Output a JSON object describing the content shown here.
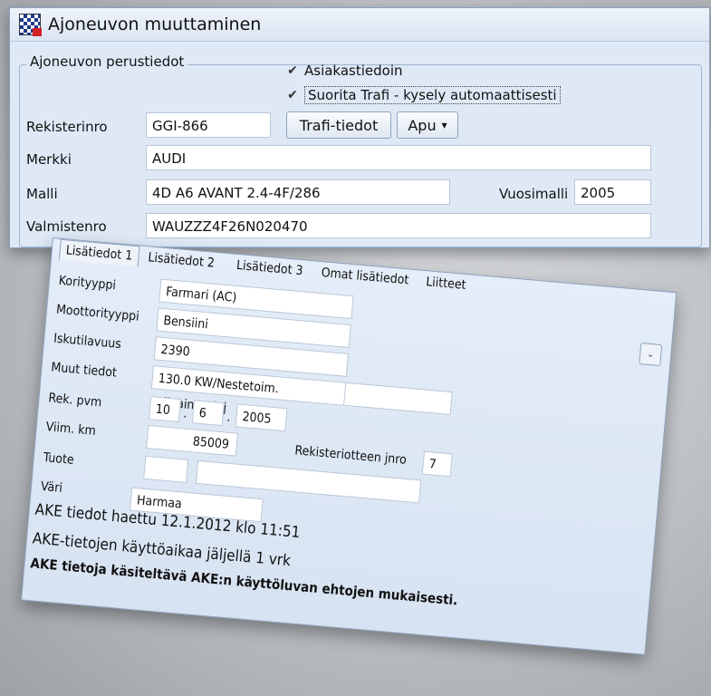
{
  "window": {
    "title": "Ajoneuvon muuttaminen"
  },
  "group": {
    "legend": "Ajoneuvon perustiedot"
  },
  "checkboxes": [
    {
      "label": "Asiakastiedoin",
      "checked": "✔"
    },
    {
      "label": "Suorita Trafi - kysely automaattisesti",
      "checked": "✔"
    }
  ],
  "fields": {
    "rekisterinro": {
      "label": "Rekisterinro",
      "value": "GGI-866"
    },
    "merkki": {
      "label": "Merkki",
      "value": "AUDI"
    },
    "malli": {
      "label": "Malli",
      "value": "4D A6 AVANT 2.4-4F/286"
    },
    "vuosimalli": {
      "label": "Vuosimalli",
      "value": "2005"
    },
    "valmistenro": {
      "label": "Valmistenro",
      "value": "WAUZZZ4F26N020470"
    }
  },
  "buttons": {
    "trafi": "Trafi-tiedot",
    "apu": "Apu",
    "apu_arrow": "▾"
  },
  "tabs": [
    "Lisätiedot 1",
    "Lisätiedot 2",
    "Lisätiedot 3",
    "Omat lisätiedot",
    "Liitteet"
  ],
  "panel": {
    "expand_icon": "⌄",
    "korityyppi": {
      "label": "Korityyppi",
      "value": "Farmari (AC)"
    },
    "moottorityyppi": {
      "label": "Moottorityyppi",
      "value": "Bensiini"
    },
    "iskutilavuus": {
      "label": "Iskutilavuus",
      "value": "2390"
    },
    "muut_tiedot": {
      "label": "Muut tiedot",
      "value": "130.0 KW/Nestetoim. alipaineteh.j"
    },
    "rek_pvm": {
      "label": "Rek. pvm",
      "day": "10",
      "month": "6",
      "year": "2005",
      "sep": "."
    },
    "viim_km": {
      "label": "Viim. km",
      "value": "85009"
    },
    "rekisteriotteen_jnro": {
      "label": "Rekisteriotteen jnro",
      "value": "7"
    },
    "tuote": {
      "label": "Tuote",
      "value": ""
    },
    "vari": {
      "label": "Väri",
      "value": "Harmaa"
    },
    "status1": "AKE tiedot haettu 12.1.2012 klo 11:51",
    "status2": "AKE-tietojen käyttöaikaa jäljellä 1 vrk",
    "notice": "AKE tietoja käsiteltävä AKE:n käyttöluvan ehtojen mukaisesti."
  }
}
